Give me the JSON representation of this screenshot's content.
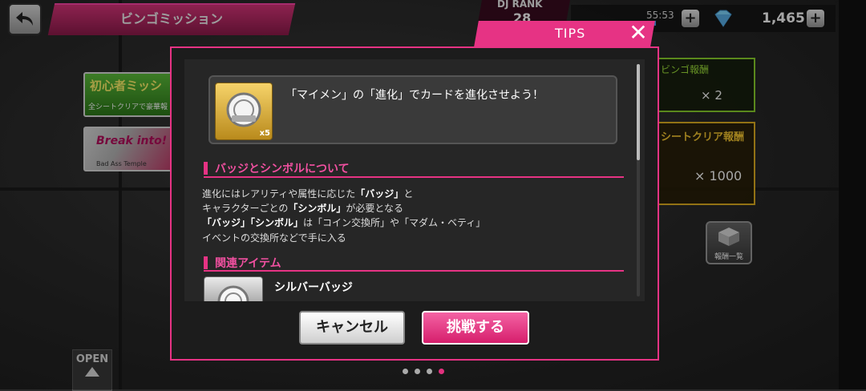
{
  "header": {
    "title": "ビンゴミッション",
    "dj_rank_label": "DJ RANK",
    "dj_rank_value": "28",
    "stamina_timer": "55:53",
    "coins": "1,465"
  },
  "left_banners": {
    "beginner_title": "初心者ミッシ",
    "beginner_sub": "全シートクリアで豪華報",
    "event_title": "Break into!",
    "event_sub": "Bad Ass Temple"
  },
  "right_panels": {
    "bingo_reward_label": "ビンゴ報酬",
    "bingo_reward_qty": "× 2",
    "sheet_clear_label": "シートクリア報酬",
    "sheet_clear_qty": "× 1000",
    "reward_list_label": "報酬一覧"
  },
  "open_label": "OPEN",
  "dialog": {
    "tab_label": "TIPS",
    "mission_text": "「マイメン」の「進化」でカードを進化させよう！",
    "badge_qty": "x5",
    "section1_title": "バッジとシンボルについて",
    "line1_a": "進化にはレアリティや属性に応じた",
    "line1_b": "「バッジ」",
    "line1_c": "と",
    "line2_a": "キャラクターごとの",
    "line2_b": "「シンボル」",
    "line2_c": "が必要となる",
    "line3_a": "「バッジ」「シンボル」",
    "line3_b": "は「コイン交換所」や「マダム・ベティ」",
    "line4": "イベントの交換所などで手に入る",
    "section2_title": "関連アイテム",
    "item_name": "シルバーバッジ",
    "cancel_label": "キャンセル",
    "challenge_label": "挑戦する"
  },
  "colors": {
    "accent": "#e63384",
    "green": "#8bd12b",
    "gold": "#e0b020"
  }
}
